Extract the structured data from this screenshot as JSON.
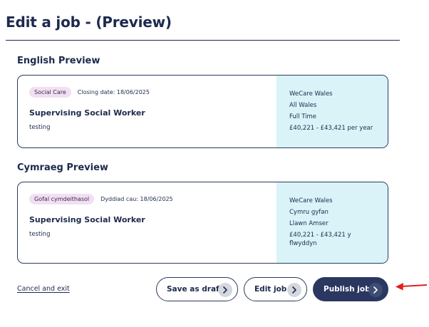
{
  "page": {
    "title": "Edit a job - (Preview)"
  },
  "english": {
    "heading": "English Preview",
    "tag": "Social Care",
    "closing": "Closing date: 18/06/2025",
    "job_title": "Supervising Social Worker",
    "description": "testing",
    "employer": "WeCare Wales",
    "location": "All Wales",
    "hours": "Full Time",
    "salary": "£40,221 - £43,421 per year"
  },
  "welsh": {
    "heading": "Cymraeg Preview",
    "tag": "Gofal cymdeithasol",
    "closing": "Dyddiad cau: 18/06/2025",
    "job_title": "Supervising Social Worker",
    "description": "testing",
    "employer": "WeCare Wales",
    "location": "Cymru gyfan",
    "hours": "Llawn Amser",
    "salary": "£40,221 - £43,421 y flwyddyn"
  },
  "actions": {
    "cancel": "Cancel and exit",
    "save_draft": "Save as draft",
    "edit_job": "Edit job",
    "publish_job": "Publish job"
  },
  "colors": {
    "navy": "#1d2a4d",
    "tag_bg": "#f2dff3",
    "side_bg": "#d9f3f8",
    "annotation_arrow": "#e02020"
  },
  "icons": {
    "button_chevron": "chevron-right-icon",
    "annotation": "red-arrow-icon"
  }
}
